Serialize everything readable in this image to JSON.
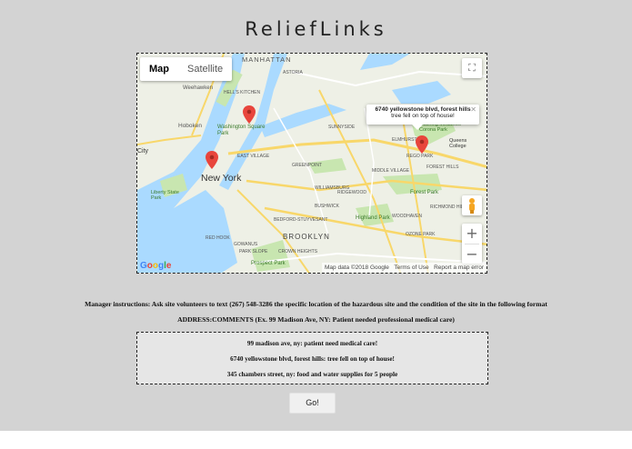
{
  "app": {
    "title": "ReliefLinks"
  },
  "map": {
    "type_buttons": [
      "Map",
      "Satellite"
    ],
    "active_type": "Map",
    "info_window": {
      "address": "6740 yellowstone blvd, forest hills",
      "comment": "tree fell on top of house!"
    },
    "labels": {
      "manhattan": "MANHATTAN",
      "weehawken": "Weehawken",
      "hells_kitchen": "HELL'S KITCHEN",
      "hoboken": "Hoboken",
      "washington_sq": "Washington Square Park",
      "new_york": "New York",
      "east_village": "EAST VILLAGE",
      "city": "City",
      "liberty": "Liberty State Park",
      "williamsburg": "WILLIAMSBURG",
      "greenpoint": "GREENPOINT",
      "sunnyside": "SUNNYSIDE",
      "elmhurst": "ELMHURST",
      "rego_park": "REGO PARK",
      "forest_park": "Forest Park",
      "highland_park": "Highland Park",
      "brooklyn": "BROOKLYN",
      "prospect_park": "Prospect Park",
      "ridgewood": "RIDGEWOOD",
      "bushwick": "BUSHWICK",
      "queens_college": "Queens College",
      "astoria": "ASTORIA",
      "flushing_meadows": "Flushing Meadows Corona Park",
      "forest_hills": "FOREST HILLS",
      "middle_village": "MIDDLE VILLAGE",
      "bed_stuy": "BEDFORD-STUYVESANT",
      "crown_heights": "CROWN HEIGHTS",
      "park_slope": "PARK SLOPE",
      "red_hook": "RED HOOK",
      "gowanus": "GOWANUS",
      "woodhaven": "WOODHAVEN",
      "ozone_park": "OZONE PARK",
      "richmond_hill": "RICHMOND HILL"
    },
    "attribution": "Map data ©2018 Google",
    "terms": "Terms of Use",
    "report": "Report a map error",
    "google_logo": "Google",
    "fullscreen_icon": "fullscreen-icon",
    "zoom_in": "+",
    "zoom_out": "−"
  },
  "instructions": "Manager instructions: Ask site volunteers to text (267) 548-3286 the specific location of the hazardous site and the condition of the site in the following format",
  "format": "ADDRESS:COMMENTS (Ex. 99 Madison Ave, NY: Patient needed professional medical care)",
  "entries": [
    "99 madison ave, ny: patient need medical care!",
    "6740 yellowstone blvd, forest hills: tree fell on top of house!",
    "345 chambers street, ny: food and water supplies for 5 people"
  ],
  "go_label": "Go!",
  "colors": {
    "background": "#d3d3d3",
    "water": "#aadaff",
    "park": "#c8e6b0",
    "pin": "#e8453c"
  }
}
